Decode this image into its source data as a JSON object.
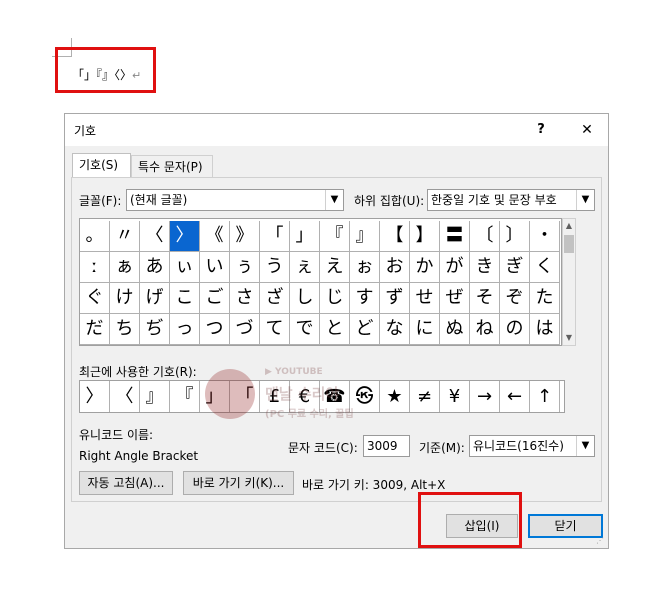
{
  "document": {
    "text": "「」『』〈〉",
    "paragraph_mark": "↵"
  },
  "dialog": {
    "title": "기호",
    "help": "?",
    "close": "✕",
    "tabs": [
      {
        "label": "기호(S)",
        "active": true
      },
      {
        "label": "특수 문자(P)",
        "active": false
      }
    ],
    "font_label": "글꼴(F):",
    "font_value": "(현재 글꼴)",
    "subset_label": "하위 집합(U):",
    "subset_value": "한중일 기호 및 문장 부호",
    "symbols": [
      [
        "。",
        "〃",
        "〈",
        "〉",
        "《",
        "》",
        "「",
        "」",
        "『",
        "』",
        "【",
        "】",
        "〓",
        "〔",
        "〕",
        "・"
      ],
      [
        "ː",
        "ぁ",
        "あ",
        "ぃ",
        "い",
        "ぅ",
        "う",
        "ぇ",
        "え",
        "ぉ",
        "お",
        "か",
        "が",
        "き",
        "ぎ",
        "く"
      ],
      [
        "ぐ",
        "け",
        "げ",
        "こ",
        "ご",
        "さ",
        "ざ",
        "し",
        "じ",
        "す",
        "ず",
        "せ",
        "ぜ",
        "そ",
        "ぞ",
        "た"
      ],
      [
        "だ",
        "ち",
        "ぢ",
        "っ",
        "つ",
        "づ",
        "て",
        "で",
        "と",
        "ど",
        "な",
        "に",
        "ぬ",
        "ね",
        "の",
        "は"
      ]
    ],
    "selected_symbol": "〉",
    "recent_label": "최근에 사용한 기호(R):",
    "recent": [
      "〉",
      "〈",
      "』",
      "『",
      "」",
      "「",
      "£",
      "€",
      "☎",
      "㉿",
      "★",
      "≠",
      "¥",
      "→",
      "←",
      "↑"
    ],
    "unicode_name_label": "유니코드 이름:",
    "unicode_name_value": "Right Angle Bracket",
    "char_code_label": "문자 코드(C):",
    "char_code_value": "3009",
    "from_label": "기준(M):",
    "from_value": "유니코드(16진수)",
    "autocorrect_button": "자동 고침(A)...",
    "shortcut_key_button": "바로 가기 키(K)...",
    "shortcut_key_text": "바로 가기 키: 3009, Alt+X",
    "insert_button": "삽입(I)",
    "close_button": "닫기"
  },
  "watermark": {
    "youtube": "▶ YOUTUBE",
    "line1": "맨날 수리야",
    "line2": "(PC 무료 수리, 꿀팁"
  },
  "colors": {
    "highlight_box": "#e01010",
    "selection": "#0a66d0"
  }
}
